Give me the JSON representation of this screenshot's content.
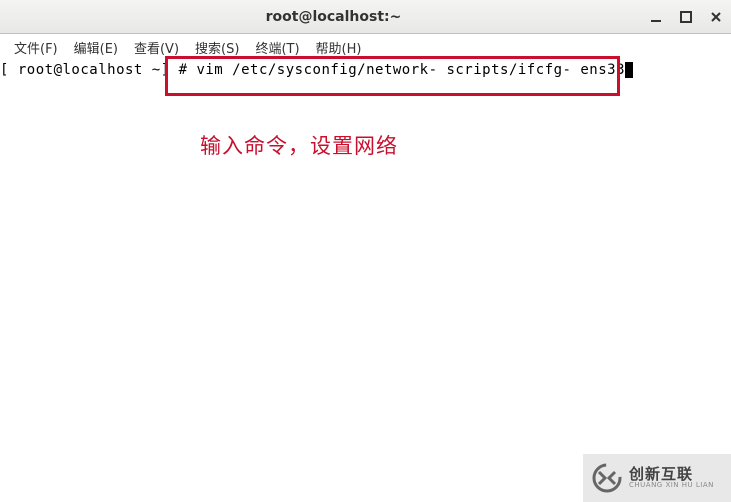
{
  "window": {
    "title": "root@localhost:~"
  },
  "menu": {
    "file": "文件(F)",
    "edit": "编辑(E)",
    "view": "查看(V)",
    "search": "搜索(S)",
    "terminal": "终端(T)",
    "help": "帮助(H)"
  },
  "terminal": {
    "prompt": "[ root@localhost ~] # ",
    "command": "vim /etc/sysconfig/network- scripts/ifcfg- ens33"
  },
  "annotation": {
    "text": "输入命令，设置网络"
  },
  "watermark": {
    "cn": "创新互联",
    "en": "CHUANG XIN HU LIAN"
  },
  "colors": {
    "highlight_red": "#c8102e",
    "annotation_red": "#c8102e"
  }
}
